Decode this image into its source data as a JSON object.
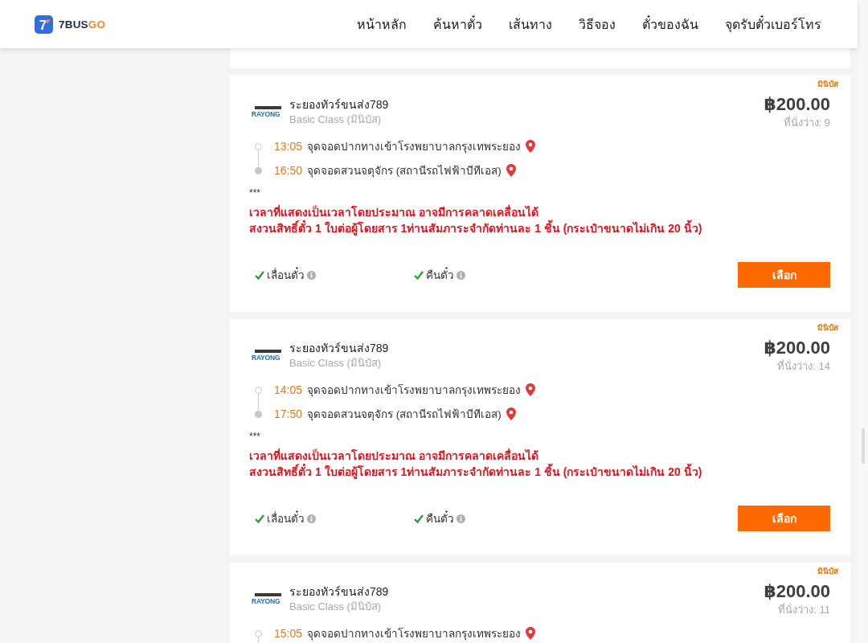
{
  "header": {
    "logo": {
      "mark": "7",
      "name_main": "7BUS",
      "name_accent": "GO"
    },
    "nav": [
      "หน้าหลัก",
      "ค้นหาตั๋ว",
      "เส้นทาง",
      "วิธีจอง",
      "ตั๋วของฉัน",
      "จุดรับตั๋วเบอร์โทร"
    ]
  },
  "results": [
    {
      "tag": "มินิบัส",
      "operator": {
        "logo_text": "RAYONG",
        "name": "ระยองทัวร์ขนส่ง789",
        "class": "Basic Class (มินิบัส)"
      },
      "price": "฿200.00",
      "seats": "ที่นั่งว่าง: 9",
      "stops": [
        {
          "kind": "origin",
          "time": "13:05",
          "place": "จุดจอดปากทางเข้าโรงพยาบาลกรุงเทพระยอง"
        },
        {
          "kind": "destination",
          "time": "16:50",
          "place": "จุดจอดสวนจตุจักร (สถานีรถไฟฟ้าบีทีเอส)"
        }
      ],
      "remarks": [
        {
          "kind": "plain",
          "text": "***"
        },
        {
          "kind": "warning",
          "text": "เวลาที่แสดงเป็นเวลาโดยประมาณ อาจมีการคลาดเคลื่อนได้"
        },
        {
          "kind": "warning",
          "text": "สงวนสิทธิ์ตั๋ว 1 ใบต่อผู้โดยสาร 1ท่านสัมภาระจำกัดท่านละ 1 ชิ้น (กระเป๋าขนาดไม่เกิน 20 นิ้ว)"
        }
      ],
      "features": [
        {
          "label": "เลื่อนตั๋ว",
          "available": true
        },
        {
          "label": "คืนตั๋ว",
          "available": true
        }
      ],
      "button": "เลือก"
    },
    {
      "tag": "มินิบัส",
      "operator": {
        "logo_text": "RAYONG",
        "name": "ระยองทัวร์ขนส่ง789",
        "class": "Basic Class (มินิบัส)"
      },
      "price": "฿200.00",
      "seats": "ที่นั่งว่าง: 14",
      "stops": [
        {
          "kind": "origin",
          "time": "14:05",
          "place": "จุดจอดปากทางเข้าโรงพยาบาลกรุงเทพระยอง"
        },
        {
          "kind": "destination",
          "time": "17:50",
          "place": "จุดจอดสวนจตุจักร (สถานีรถไฟฟ้าบีทีเอส)"
        }
      ],
      "remarks": [
        {
          "kind": "plain",
          "text": "***"
        },
        {
          "kind": "warning",
          "text": "เวลาที่แสดงเป็นเวลาโดยประมาณ อาจมีการคลาดเคลื่อนได้"
        },
        {
          "kind": "warning",
          "text": "สงวนสิทธิ์ตั๋ว 1 ใบต่อผู้โดยสาร 1ท่านสัมภาระจำกัดท่านละ 1 ชิ้น (กระเป๋าขนาดไม่เกิน 20 นิ้ว)"
        }
      ],
      "features": [
        {
          "label": "เลื่อนตั๋ว",
          "available": true
        },
        {
          "label": "คืนตั๋ว",
          "available": true
        }
      ],
      "button": "เลือก"
    },
    {
      "tag": "มินิบัส",
      "operator": {
        "logo_text": "RAYONG",
        "name": "ระยองทัวร์ขนส่ง789",
        "class": "Basic Class (มินิบัส)"
      },
      "price": "฿200.00",
      "seats": "ที่นั่งว่าง: 11",
      "stops": [
        {
          "kind": "origin",
          "time": "15:05",
          "place": "จุดจอดปากทางเข้าโรงพยาบาลกรุงเทพระยอง"
        }
      ]
    }
  ]
}
